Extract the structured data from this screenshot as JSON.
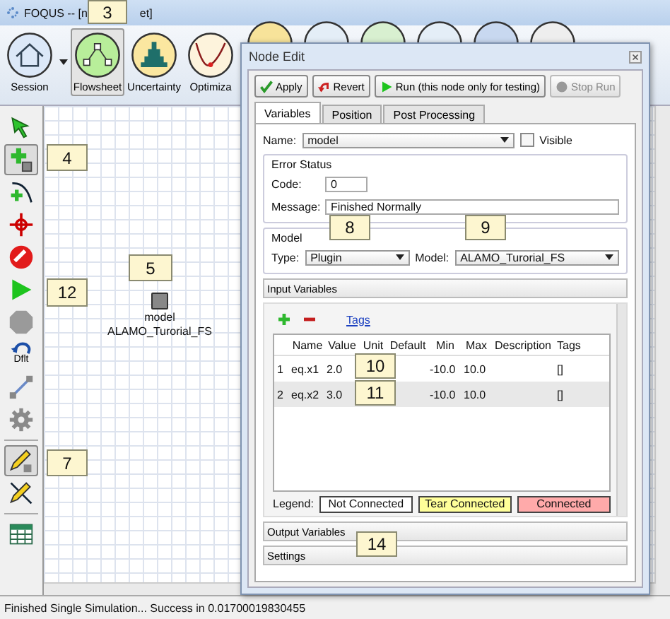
{
  "window": {
    "title_start": "FOQUS -- [n",
    "title_end": "et]"
  },
  "ribbon": [
    {
      "kind": "session",
      "label": "Session",
      "selected": false,
      "dropdown": true
    },
    {
      "kind": "flowsheet",
      "label": "Flowsheet",
      "selected": true,
      "dropdown": false
    },
    {
      "kind": "uncertainty",
      "label": "Uncertainty",
      "selected": false,
      "dropdown": false
    },
    {
      "kind": "optimization",
      "label": "Optimiza",
      "selected": false,
      "dropdown": false
    }
  ],
  "toolbar": [
    {
      "kind": "select",
      "selected": false
    },
    {
      "kind": "add-node",
      "selected": true
    },
    {
      "kind": "add-edge",
      "selected": false
    },
    {
      "kind": "center",
      "selected": false
    },
    {
      "kind": "stop",
      "selected": false
    },
    {
      "kind": "run",
      "selected": false
    },
    {
      "kind": "halt",
      "selected": false
    },
    {
      "kind": "default",
      "label": "Dflt",
      "selected": false
    },
    {
      "kind": "link",
      "selected": false
    },
    {
      "kind": "gear",
      "selected": false
    },
    {
      "kind": "edit",
      "selected": true
    },
    {
      "kind": "delete",
      "selected": false
    },
    {
      "kind": "table",
      "selected": false
    }
  ],
  "canvas": {
    "node": {
      "name": "model",
      "model": "ALAMO_Turorial_FS"
    }
  },
  "status_bar": "Finished Single Simulation... Success in 0.01700019830455",
  "node_edit": {
    "title": "Node Edit",
    "buttons": [
      {
        "kind": "apply",
        "label": "Apply",
        "disabled": false
      },
      {
        "kind": "revert",
        "label": "Revert",
        "disabled": false
      },
      {
        "kind": "run",
        "label": "Run (this node only for testing)",
        "disabled": false
      },
      {
        "kind": "stop",
        "label": "Stop Run",
        "disabled": true
      }
    ],
    "tabs": [
      {
        "label": "Variables",
        "selected": true
      },
      {
        "label": "Position",
        "selected": false
      },
      {
        "label": "Post Processing",
        "selected": false
      }
    ],
    "name_label": "Name:",
    "name": "model",
    "visible_label": "Visible",
    "visible": false,
    "error_status": {
      "title": "Error Status",
      "code_label": "Code:",
      "code": "0",
      "message_label": "Message:",
      "message": "Finished Normally"
    },
    "model": {
      "title": "Model",
      "type_label": "Type:",
      "type": "Plugin",
      "model_label": "Model:",
      "model": "ALAMO_Turorial_FS"
    },
    "input_variables": {
      "title": "Input Variables",
      "tags_link": "Tags",
      "columns": [
        "Name",
        "Value",
        "Unit",
        "Default",
        "Min",
        "Max",
        "Description",
        "Tags"
      ],
      "rows": [
        {
          "index": "1",
          "cells": [
            "eq.x1",
            "2.0",
            "",
            "",
            "-10.0",
            "10.0",
            "",
            "[]"
          ]
        },
        {
          "index": "2",
          "cells": [
            "eq.x2",
            "3.0",
            "",
            "",
            "-10.0",
            "10.0",
            "",
            "[]"
          ]
        }
      ],
      "legend_label": "Legend:",
      "legend": [
        {
          "label": "Not Connected",
          "color": "#ffffff"
        },
        {
          "label": "Tear Connected",
          "color": "#ffff99"
        },
        {
          "label": "Connected",
          "color": "#ffaaaa"
        }
      ]
    },
    "sections": [
      "Output Variables",
      "Settings"
    ]
  },
  "callouts": [
    "3",
    "4",
    "5",
    "12",
    "7",
    "8",
    "9",
    "10",
    "11",
    "14"
  ]
}
